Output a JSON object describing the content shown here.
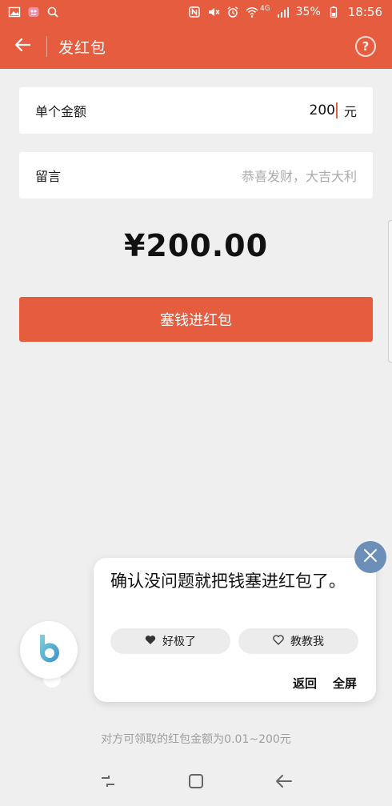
{
  "status_bar": {
    "battery": "35%",
    "time": "18:56",
    "network": "4G",
    "icons": [
      "gallery-icon",
      "app-notification-icon",
      "search-icon",
      "nfc-icon",
      "mute-icon",
      "alarm-icon",
      "wifi-icon",
      "signal-icon",
      "battery-icon"
    ]
  },
  "toolbar": {
    "title": "发红包",
    "back_icon": "arrow-left-icon",
    "help_icon": "help-circle-icon",
    "help_glyph": "?"
  },
  "form": {
    "amount_label": "单个金额",
    "amount_value": "200",
    "amount_unit": "元",
    "message_label": "留言",
    "message_placeholder": "恭喜发财，大吉大利"
  },
  "total_amount": "¥200.00",
  "submit_label": "塞钱进红包",
  "assistant": {
    "message": "确认没问题就把钱塞进红包了。",
    "like_label": "好极了",
    "teach_label": "教教我",
    "back_label": "返回",
    "fullscreen_label": "全屏"
  },
  "hint": "对方可领取的红包金额为0.01~200元",
  "colors": {
    "accent": "#e65c3e",
    "background": "#efefef",
    "close_button": "#6b8fb8"
  }
}
